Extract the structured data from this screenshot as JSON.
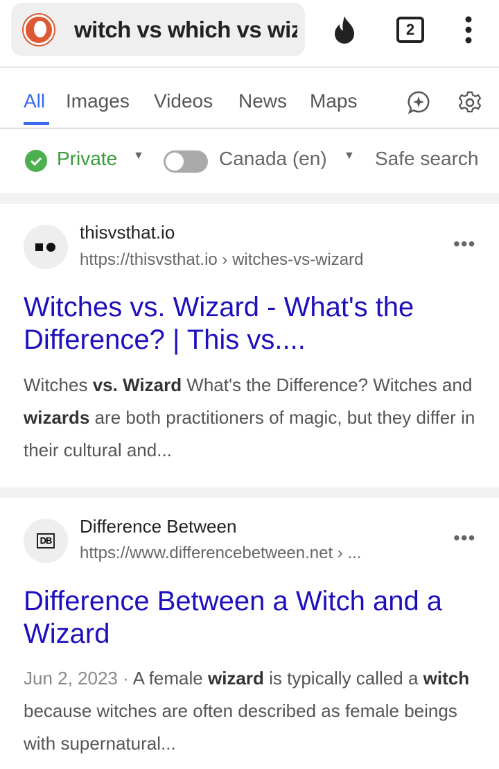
{
  "header": {
    "query": "witch vs which vs wizard",
    "tab_count": "2",
    "icons": [
      "duckduckgo-logo",
      "fire-icon",
      "tabs-icon",
      "more-vert-icon"
    ]
  },
  "tabs": [
    {
      "label": "All",
      "active": true
    },
    {
      "label": "Images"
    },
    {
      "label": "Videos"
    },
    {
      "label": "News"
    },
    {
      "label": "Maps"
    }
  ],
  "tab_icons": [
    "assist-chat-icon",
    "gear-icon"
  ],
  "filters": {
    "private": "Private",
    "region": "Canada (en)",
    "region_toggle": false,
    "safe_search": "Safe search"
  },
  "colors": {
    "accent": "#3969ef",
    "link": "#1e0fbe",
    "private_green": "#4caf50"
  },
  "results": [
    {
      "site": "thisvsthat.io",
      "url": "https://thisvsthat.io › witches-vs-wizard",
      "title": "Witches vs. Wizard - What's the Difference? | This vs....",
      "snippet": [
        [
          "Witches ",
          false
        ],
        [
          "vs.",
          true
        ],
        [
          " ",
          false
        ],
        [
          "Wizard",
          true
        ],
        [
          " What's the Difference? Witches and ",
          false
        ],
        [
          "wizards",
          true
        ],
        [
          " are both practitioners of magic, but they differ in their cultural and...",
          false
        ]
      ]
    },
    {
      "site": "Difference Between",
      "url": "https://www.differencebetween.net › ...",
      "title": "Difference Between a Witch and a Wizard",
      "date": "Jun 2, 2023",
      "snippet": [
        [
          "A female ",
          false
        ],
        [
          "wizard",
          true
        ],
        [
          " is typically called a ",
          false
        ],
        [
          "witch",
          true
        ],
        [
          " because witches are often described as female beings with supernatural...",
          false
        ]
      ]
    }
  ]
}
